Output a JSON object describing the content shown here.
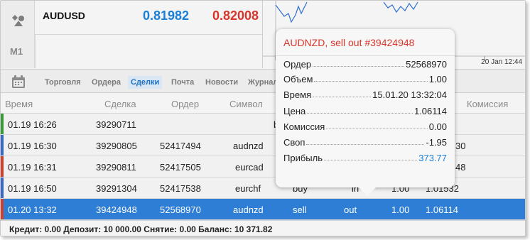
{
  "tools": {
    "timeframe": "M1"
  },
  "quote": {
    "symbol": "AUDUSD",
    "bid": "0.81982",
    "ask": "0.82008"
  },
  "chart": {
    "date_label": "20 Jan 12:44"
  },
  "tabs": [
    {
      "label": "Торговля",
      "active": false
    },
    {
      "label": "Ордера",
      "active": false
    },
    {
      "label": "Сделки",
      "active": true
    },
    {
      "label": "Почта",
      "active": false
    },
    {
      "label": "Новости",
      "active": false
    },
    {
      "label": "Журнал",
      "active": false
    }
  ],
  "table": {
    "columns": [
      "Время",
      "Сделка",
      "Ордер",
      "Символ",
      "Комиссия"
    ],
    "rows": [
      {
        "time": "01.19 16:26",
        "deal": "39290711",
        "order": "",
        "symbol": "b",
        "type": "",
        "dir": "",
        "vol": "",
        "price": "",
        "side_color": "#3a9a3a",
        "selected": false
      },
      {
        "time": "01.19 16:30",
        "deal": "39290805",
        "order": "52417494",
        "symbol": "audnzd",
        "type": "",
        "dir": "",
        "vol": "",
        "price": "30",
        "side_color": "#3a68c4",
        "selected": false
      },
      {
        "time": "01.19 16:31",
        "deal": "39290811",
        "order": "52417505",
        "symbol": "eurcad",
        "type": "",
        "dir": "",
        "vol": "",
        "price": "48",
        "side_color": "#d0402e",
        "selected": false
      },
      {
        "time": "01.19 16:50",
        "deal": "39291304",
        "order": "52417538",
        "symbol": "eurchf",
        "type": "buy",
        "dir": "in",
        "vol": "1.00",
        "price": "1.01532",
        "side_color": "#3a68c4",
        "selected": false
      },
      {
        "time": "01.20 13:32",
        "deal": "39424948",
        "order": "52568970",
        "symbol": "audnzd",
        "type": "sell",
        "dir": "out",
        "vol": "1.00",
        "price": "1.06114",
        "side_color": "#d0402e",
        "selected": true
      }
    ]
  },
  "footer": {
    "text": "Кредит: 0.00 Депозит: 10 000.00 Снятие: 0.00 Баланс: 10 371.82"
  },
  "popup": {
    "title": "AUDNZD, sell out #39424948",
    "rows": [
      {
        "label": "Ордер",
        "value": "52568970"
      },
      {
        "label": "Объем",
        "value": "1.00"
      },
      {
        "label": "Время",
        "value": "15.01.20 13:32:04"
      },
      {
        "label": "Цена",
        "value": "1.06114"
      },
      {
        "label": "Комиссия",
        "value": "0.00"
      },
      {
        "label": "Своп",
        "value": "-1.95"
      },
      {
        "label": "Прибыль",
        "value": "373.77"
      }
    ]
  },
  "colors": {
    "bid": "#1a7fd8",
    "ask": "#d9352b",
    "selected_row": "#2f7ed6",
    "profit": "#1a7fd8"
  }
}
